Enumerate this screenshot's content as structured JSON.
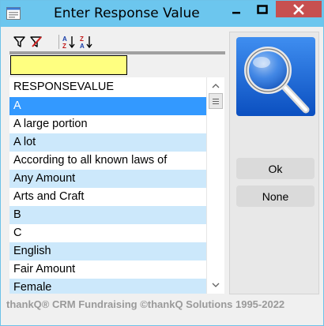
{
  "window": {
    "title": "Enter Response Value",
    "controls": [
      "minimize-icon",
      "maximize-icon",
      "close-icon"
    ]
  },
  "toolbar": {
    "icons": [
      "filter-icon",
      "clear-filter-icon",
      "sort-ascending-icon",
      "sort-descending-icon"
    ]
  },
  "filter": {
    "value": ""
  },
  "grid": {
    "column_header": "RESPONSEVALUE",
    "rows": [
      "A",
      "A large portion",
      "A lot",
      "According to all known laws of",
      "Any Amount",
      "Arts and Craft",
      "B",
      "C",
      "English",
      "Fair Amount",
      "Female"
    ],
    "selected_index": 0
  },
  "buttons": {
    "ok": "Ok",
    "none": "None"
  },
  "footer": {
    "text": "thankQ® CRM Fundraising ©thankQ Solutions 1995-2022"
  },
  "colors": {
    "titlebar": "#6cc6ee",
    "close_button": "#c75050",
    "selected_row": "#3399ff",
    "alt_row": "#cce8fb",
    "filter_field": "#ffff80"
  }
}
